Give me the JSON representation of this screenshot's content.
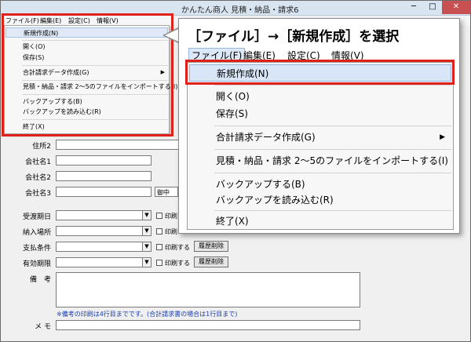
{
  "window": {
    "title": "かんたん商人 見積・納品・請求6",
    "min": "─",
    "max": "□",
    "close": "✕"
  },
  "menubar": [
    "ファイル(F)",
    "編集(E)",
    "設定(C)",
    "情報(V)"
  ],
  "file_menu": {
    "new": "新規作成(N)",
    "open": "開く(O)",
    "save": "保存(S)",
    "invoice_data": "合計請求データ作成(G)",
    "import": "見積・納品・請求 2～5のファイルをインポートする(I)",
    "backup": "バックアップする(B)",
    "restore": "バックアップを読み込む(R)",
    "exit": "終了(X)",
    "submenu_arrow": "▶"
  },
  "instruction": "［ファイル］→［新規作成］を選択",
  "form": {
    "address2": "住所2",
    "company1": "会社名1",
    "company2": "会社名2",
    "company3": "会社名3",
    "honorific": "御中",
    "delivery_date": "受渡期日",
    "delivery_place": "納入場所",
    "payment_terms": "支払条件",
    "expiry": "有効期限",
    "remarks": "備　考",
    "memo": "メ モ",
    "print_label": "印刷する",
    "print_label_short": "印刷",
    "history_delete": "履歴削除",
    "note": "※備考の印刷は4行目までです。(合計請求書の場合は1行目まで)"
  },
  "icons": [
    "dropdown-arrow-icon",
    "submenu-arrow-icon",
    "close-icon",
    "minimize-icon",
    "maximize-icon"
  ],
  "colors": {
    "highlight_frame": "#e0211a",
    "menu_highlight": "#d8e6f8",
    "note_text": "#1a3fb0"
  }
}
